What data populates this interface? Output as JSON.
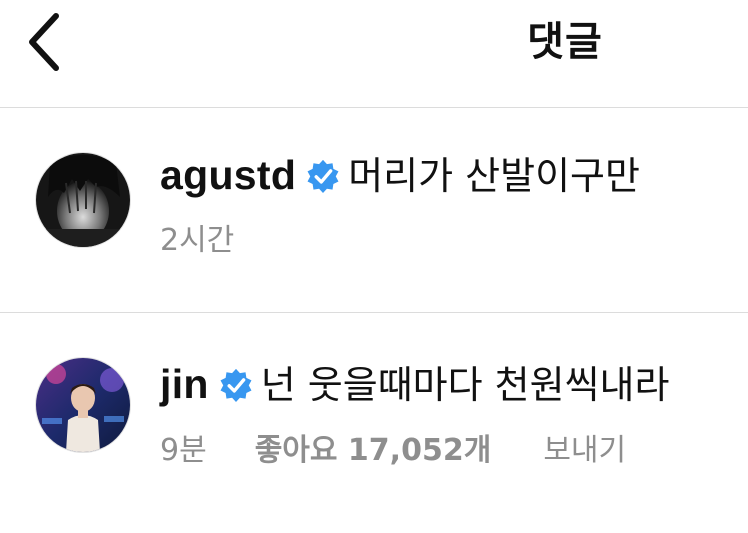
{
  "header": {
    "back_icon": "chevron-left-icon",
    "title": "댓글"
  },
  "colors": {
    "verified": "#3897f0",
    "meta_text": "#8e8e8e",
    "divider": "#dcdcdc"
  },
  "comments": [
    {
      "username": "agustd",
      "verified": true,
      "text": "머리가 산발이구만",
      "time": "2시간"
    },
    {
      "username": "jin",
      "verified": true,
      "text": "넌 웃을때마다 천원씩내라",
      "time": "9분",
      "likes": "좋아요 17,052개",
      "reply": "보내기"
    }
  ]
}
